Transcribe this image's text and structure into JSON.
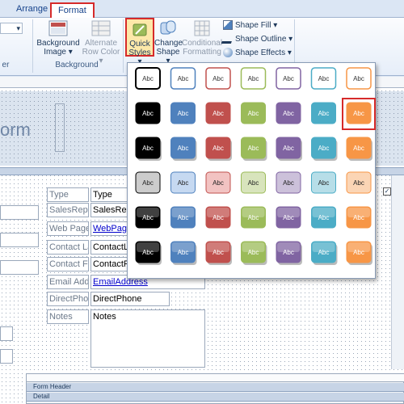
{
  "ribbon": {
    "tabs": [
      "Arrange",
      "Format"
    ],
    "left_fragment_label": "er",
    "groups": {
      "background": {
        "label": "Background",
        "background_image_line1": "Background",
        "background_image_line2": "Image ▾",
        "alternate_row_color_line1": "Alternate",
        "alternate_row_color_line2": "Row Color ▾"
      },
      "control": {
        "quick_styles_line1": "Quick",
        "quick_styles_line2": "Styles ▾",
        "change_shape_line1": "Change",
        "change_shape_line2": "Shape ▾",
        "conditional_line1": "Conditional",
        "conditional_line2": "Formatting",
        "shape_fill": "Shape Fill ▾",
        "shape_outline": "Shape Outline ▾",
        "shape_effects": "Shape Effects ▾"
      }
    }
  },
  "form": {
    "title_fragment": "orm",
    "labels": [
      "Type",
      "SalesRep",
      "Web Page",
      "Contact La",
      "Contact Fi",
      "Email Add",
      "DirectPhon",
      "Notes"
    ],
    "fields": [
      "Type",
      "SalesRep",
      "WebPage",
      "ContactLa",
      "ContactF",
      "EmailAddress",
      "DirectPhone",
      "Notes"
    ],
    "subform_bands": [
      "Form Header",
      "Detail"
    ]
  },
  "gallery": {
    "swatch_label": "Abc",
    "colors": [
      "#000000",
      "#4f81bd",
      "#c0504d",
      "#9bbb59",
      "#8064a2",
      "#4bacc6",
      "#f79646"
    ],
    "light_colors": [
      "#cccccc",
      "#c6d9f1",
      "#f2c3c2",
      "#d8e4bc",
      "#ccc1da",
      "#b7dee8",
      "#fbd5b5"
    ]
  }
}
